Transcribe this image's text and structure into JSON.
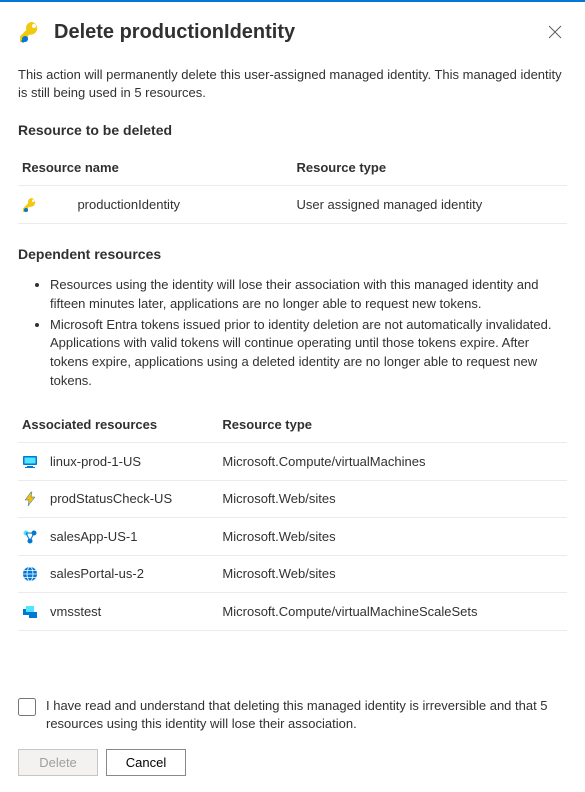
{
  "header": {
    "title": "Delete productionIdentity"
  },
  "description": "This action will permanently delete this user-assigned managed identity. This managed identity is still being used in 5 resources.",
  "deleted_section": {
    "title": "Resource to be deleted",
    "columns": {
      "name": "Resource name",
      "type": "Resource type"
    },
    "rows": [
      {
        "icon": "key-identity-icon",
        "name": "productionIdentity",
        "type": "User assigned managed identity"
      }
    ]
  },
  "dependent_section": {
    "title": "Dependent resources",
    "bullets": [
      "Resources using the identity will lose their association with this managed identity and fifteen minutes later, applications are no longer able to request new tokens.",
      "Microsoft Entra tokens issued prior to identity deletion are not automatically invalidated. Applications with valid tokens will continue operating until those tokens expire. After tokens expire, applications using a deleted identity are no longer able to request new tokens."
    ],
    "columns": {
      "name": "Associated resources",
      "type": "Resource type"
    },
    "rows": [
      {
        "icon": "vm-icon",
        "name": "linux-prod-1-US",
        "type": "Microsoft.Compute/virtualMachines"
      },
      {
        "icon": "function-icon",
        "name": "prodStatusCheck-US",
        "type": "Microsoft.Web/sites"
      },
      {
        "icon": "webapp-icon",
        "name": "salesApp-US-1",
        "type": "Microsoft.Web/sites"
      },
      {
        "icon": "globe-icon",
        "name": "salesPortal-us-2",
        "type": "Microsoft.Web/sites"
      },
      {
        "icon": "vmss-icon",
        "name": "vmsstest",
        "type": "Microsoft.Compute/virtualMachineScaleSets"
      }
    ]
  },
  "consent_text": "I have read and understand that deleting this managed identity is irreversible and that 5 resources using this identity will lose their association.",
  "buttons": {
    "delete": "Delete",
    "cancel": "Cancel"
  }
}
